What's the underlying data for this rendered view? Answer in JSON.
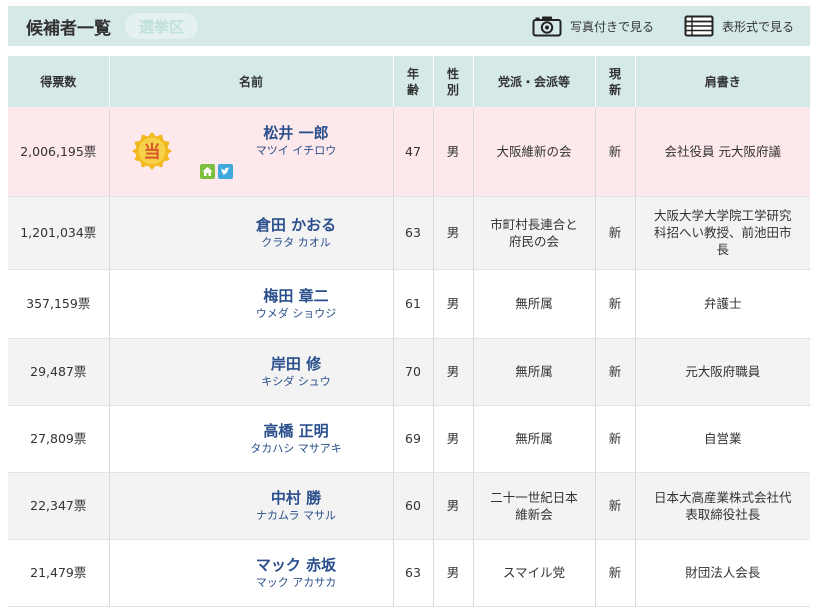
{
  "header": {
    "title": "候補者一覧",
    "tab_label": "選挙区",
    "photo_view_label": "写真付きで見る",
    "table_view_label": "表形式で見る"
  },
  "columns": {
    "votes": "得票数",
    "name": "名前",
    "age_l1": "年",
    "age_l2": "齢",
    "sex_l1": "性",
    "sex_l2": "別",
    "party": "党派・会派等",
    "status_l1": "現",
    "status_l2": "新",
    "career": "肩書き"
  },
  "elected_badge": "当",
  "colors": {
    "header_bg": "#d4e9e8",
    "elected_row": "#fde8ec",
    "name_blue": "#2a4f8c",
    "badge_gold": "#f2b91c",
    "badge_text": "#d9562b",
    "home_icon_bg": "#7cbf3f",
    "twitter_icon_bg": "#3fa9dd"
  },
  "candidates": [
    {
      "votes": "2,006,195票",
      "name": "松井 一郎",
      "kana": "マツイ イチロウ",
      "age": "47",
      "sex": "男",
      "party_l1": "大阪維新の会",
      "party_l2": "",
      "status": "新",
      "career_l1": "会社役員 元大阪府議",
      "career_l2": "",
      "career_l3": "",
      "elected": true,
      "links": [
        "home-icon",
        "twitter-icon"
      ]
    },
    {
      "votes": "1,201,034票",
      "name": "倉田 かおる",
      "kana": "クラタ カオル",
      "age": "63",
      "sex": "男",
      "party_l1": "市町村長連合と",
      "party_l2": "府民の会",
      "status": "新",
      "career_l1": "大阪大学大学院工学研究",
      "career_l2": "科招へい教授、前池田市",
      "career_l3": "長",
      "elected": false
    },
    {
      "votes": "357,159票",
      "name": "梅田 章二",
      "kana": "ウメダ ショウジ",
      "age": "61",
      "sex": "男",
      "party_l1": "無所属",
      "party_l2": "",
      "status": "新",
      "career_l1": "弁護士",
      "career_l2": "",
      "career_l3": "",
      "elected": false
    },
    {
      "votes": "29,487票",
      "name": "岸田 修",
      "kana": "キシダ シュウ",
      "age": "70",
      "sex": "男",
      "party_l1": "無所属",
      "party_l2": "",
      "status": "新",
      "career_l1": "元大阪府職員",
      "career_l2": "",
      "career_l3": "",
      "elected": false
    },
    {
      "votes": "27,809票",
      "name": "高橋 正明",
      "kana": "タカハシ マサアキ",
      "age": "69",
      "sex": "男",
      "party_l1": "無所属",
      "party_l2": "",
      "status": "新",
      "career_l1": "自営業",
      "career_l2": "",
      "career_l3": "",
      "elected": false
    },
    {
      "votes": "22,347票",
      "name": "中村 勝",
      "kana": "ナカムラ マサル",
      "age": "60",
      "sex": "男",
      "party_l1": "二十一世紀日本",
      "party_l2": "維新会",
      "status": "新",
      "career_l1": "日本大高産業株式会社代",
      "career_l2": "表取締役社長",
      "career_l3": "",
      "elected": false
    },
    {
      "votes": "21,479票",
      "name": "マック 赤坂",
      "kana": "マック アカサカ",
      "age": "63",
      "sex": "男",
      "party_l1": "スマイル党",
      "party_l2": "",
      "status": "新",
      "career_l1": "財団法人会長",
      "career_l2": "",
      "career_l3": "",
      "elected": false
    }
  ]
}
